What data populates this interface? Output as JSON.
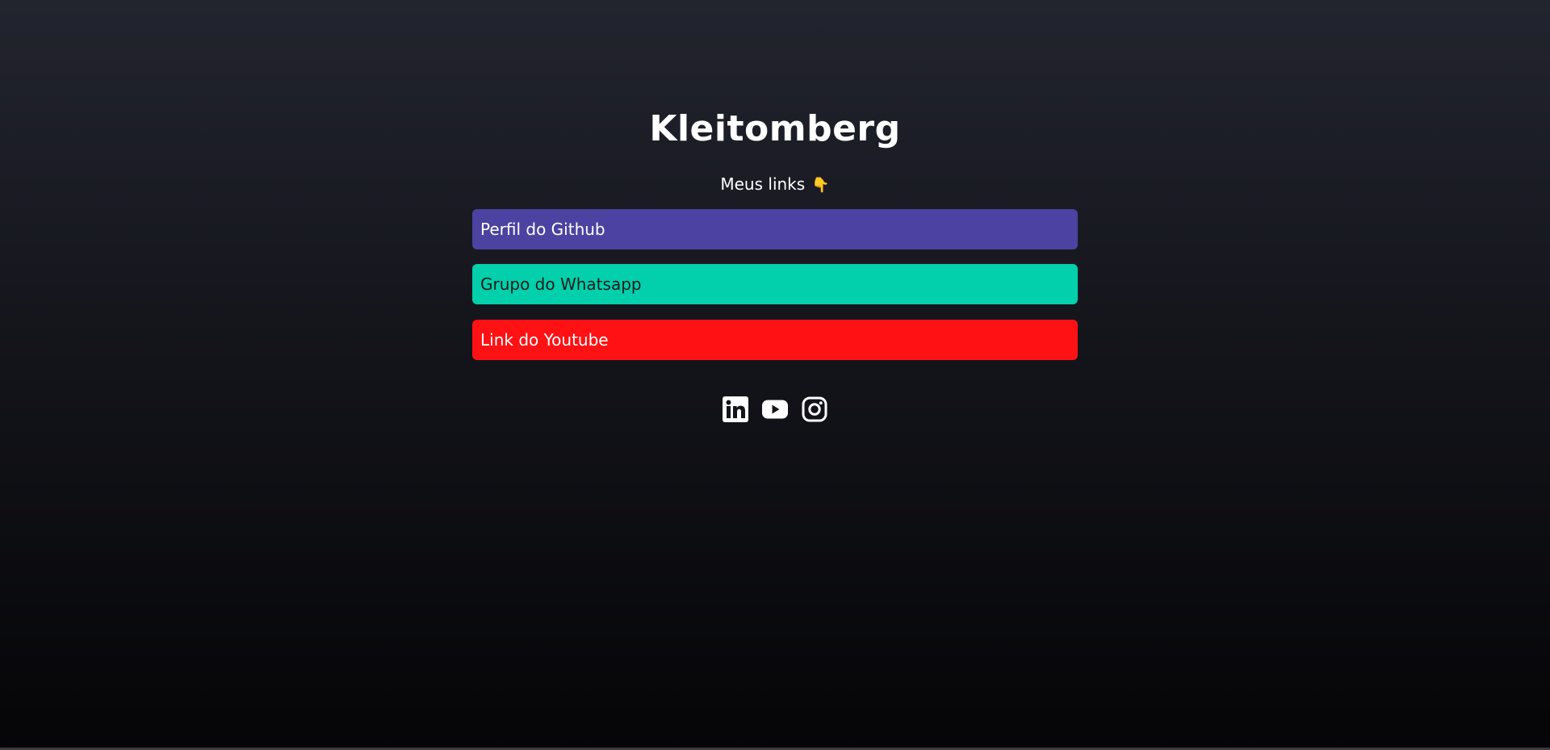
{
  "profile": {
    "name": "Kleitomberg",
    "subtitle": "Meus links",
    "subtitle_emoji": "👇"
  },
  "links": [
    {
      "label": "Perfil do Github",
      "color": "#4b42a1"
    },
    {
      "label": "Grupo do Whatsapp",
      "color": "#02d0ac"
    },
    {
      "label": "Link do Youtube",
      "color": "#ff1114"
    }
  ],
  "socials": [
    {
      "icon": "linkedin-icon"
    },
    {
      "icon": "youtube-icon"
    },
    {
      "icon": "instagram-icon"
    }
  ],
  "theme": {
    "background_top": "#22242f",
    "background_bottom": "#050507",
    "text": "#ffffff"
  }
}
